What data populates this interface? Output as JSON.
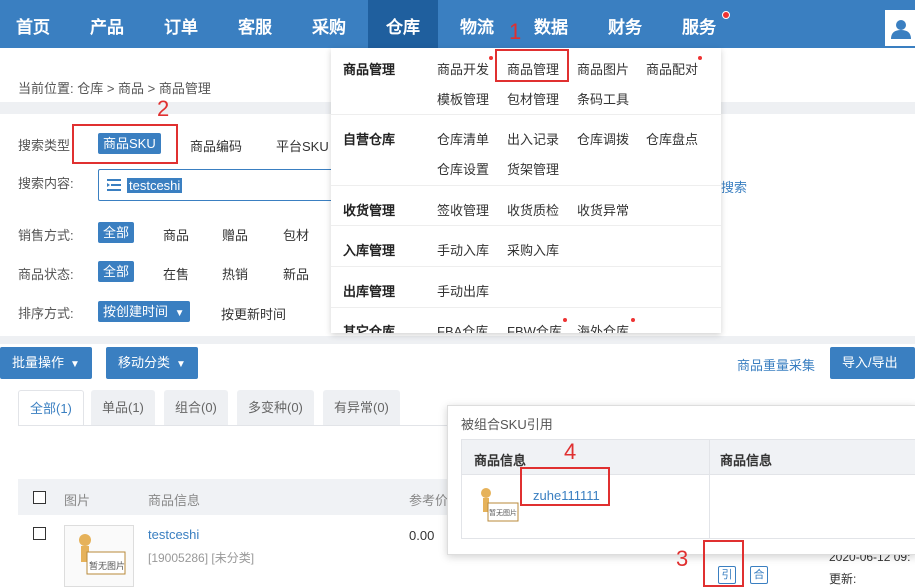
{
  "nav": {
    "items": [
      "首页",
      "产品",
      "订单",
      "客服",
      "采购",
      "仓库",
      "物流",
      "数据",
      "财务",
      "服务"
    ],
    "active": "仓库"
  },
  "breadcrumb": "当前位置:  仓库 > 商品 > 商品管理",
  "filters": {
    "search_type_label": "搜索类型",
    "search_types": [
      "商品SKU",
      "商品编码",
      "平台SKU"
    ],
    "search_content_label": "搜索内容:",
    "search_value": "testceshi",
    "search_link": "搜索",
    "sale_mode_label": "销售方式:",
    "sale_modes": [
      "全部",
      "商品",
      "赠品",
      "包材"
    ],
    "status_label": "商品状态:",
    "statuses": [
      "全部",
      "在售",
      "热销",
      "新品"
    ],
    "sort_label": "排序方式:",
    "sort_options": [
      "按创建时间",
      "按更新时间"
    ]
  },
  "toolbar": {
    "batch": "批量操作",
    "move": "移动分类",
    "weight_purchase": "商品重量采集",
    "import_export": "导入/导出"
  },
  "tabs": [
    "全部(1)",
    "单品(1)",
    "组合(0)",
    "多变种(0)",
    "有异常(0)"
  ],
  "table": {
    "headers": [
      "图片",
      "商品信息",
      "参考价"
    ],
    "row": {
      "name": "testceshi",
      "meta": "[19005286] [未分类]",
      "price": "0.00",
      "no_image": "暂无图片",
      "date": "2020-06-12 09:",
      "update_label": "更新:"
    }
  },
  "dropdown": {
    "sections": [
      {
        "title": "商品管理",
        "links": [
          "商品开发",
          "商品管理",
          "商品图片",
          "商品配对",
          "模板管理",
          "包材管理",
          "条码工具"
        ]
      },
      {
        "title": "自营仓库",
        "links": [
          "仓库清单",
          "出入记录",
          "仓库调拨",
          "仓库盘点",
          "仓库设置",
          "货架管理"
        ]
      },
      {
        "title": "收货管理",
        "links": [
          "签收管理",
          "收货质检",
          "收货异常"
        ]
      },
      {
        "title": "入库管理",
        "links": [
          "手动入库",
          "采购入库"
        ]
      },
      {
        "title": "出库管理",
        "links": [
          "手动出库"
        ]
      },
      {
        "title": "其它仓库",
        "links": [
          "FBA仓库",
          "FBW仓库",
          "海外仓库"
        ]
      }
    ]
  },
  "popup": {
    "title": "被组合SKU引用",
    "headers": [
      "商品信息",
      "商品信息"
    ],
    "sku": "zuhe111111",
    "no_image": "暂无图片"
  },
  "action_icons": [
    "引",
    "合"
  ],
  "annotations": [
    "1",
    "2",
    "3",
    "4"
  ],
  "colors": {
    "primary": "#3a7fc1",
    "annotation": "#e03030"
  }
}
